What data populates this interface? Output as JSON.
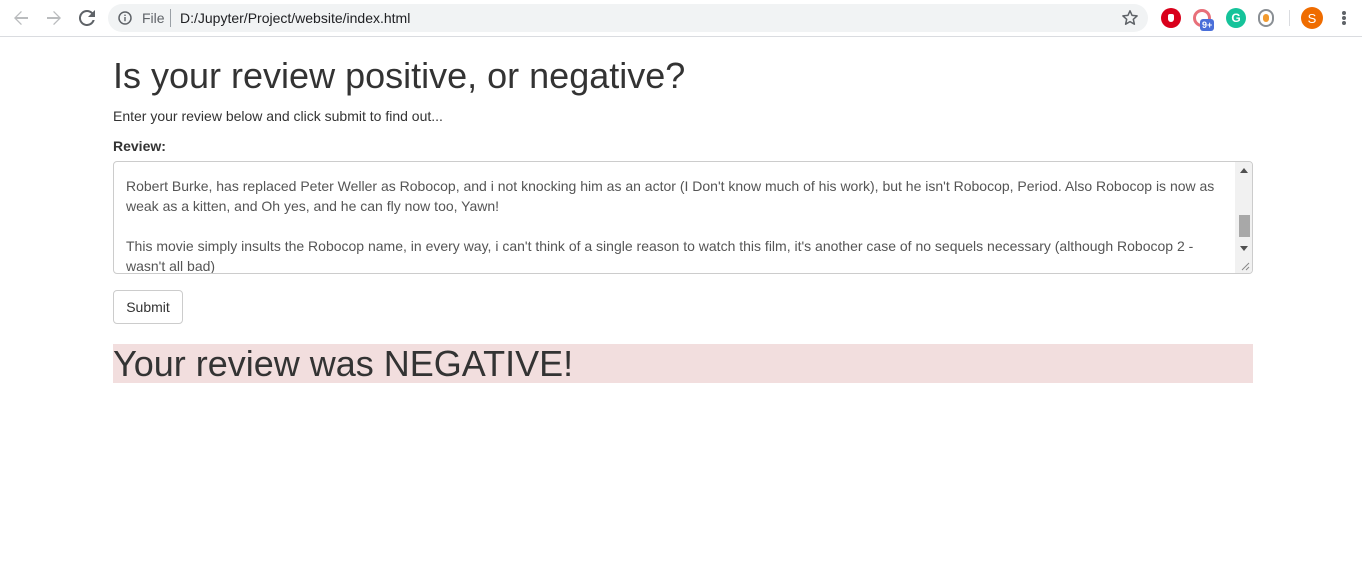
{
  "browser": {
    "scheme_label": "File",
    "url": "D:/Jupyter/Project/website/index.html",
    "extension_badge": "9+",
    "grammarly_letter": "G",
    "profile_initial": "S",
    "icons": [
      "back-arrow-icon",
      "forward-arrow-icon",
      "reload-icon",
      "info-icon",
      "star-icon",
      "adblock-icon",
      "pocket-icon",
      "grammarly-icon",
      "extension-icon",
      "kebab-menu-icon"
    ],
    "colors": {
      "profile": "#ef6c00",
      "adblock": "#d9001b",
      "grammarly": "#15c39a"
    }
  },
  "page": {
    "title": "Is your review positive, or negative?",
    "subtitle": "Enter your review below and click submit to find out...",
    "review_label": "Review:",
    "review_text": "Robert Burke, has replaced Peter Weller as Robocop, and i not knocking him as an actor (I Don't know much of his work), but he isn't Robocop, Period. Also Robocop is now as weak as a kitten, and Oh yes, and he can fly now too, Yawn!\n\nThis movie simply insults the Robocop name, in every way, i can't think of a single reason to watch this film, it's another case of no sequels necessary (although Robocop 2 - wasn't all bad)",
    "submit_label": "Submit",
    "result_text": "Your review was NEGATIVE!",
    "result_color": "#f2dede"
  }
}
